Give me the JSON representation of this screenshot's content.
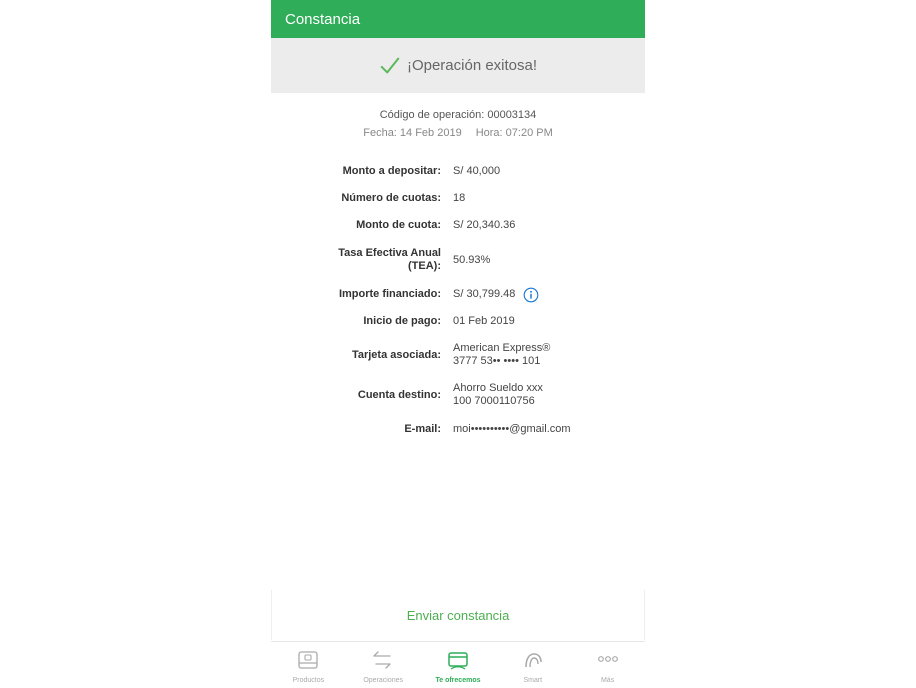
{
  "header": {
    "title": "Constancia"
  },
  "success": {
    "message": "¡Operación exitosa!",
    "icon": "check-icon"
  },
  "meta": {
    "code": "Código de operación: 00003134",
    "date": "Fecha: 14 Feb 2019",
    "time": "Hora: 07:20 PM"
  },
  "details": [
    {
      "label": "Monto a depositar:",
      "value": "S/ 40,000"
    },
    {
      "label": "Número de cuotas:",
      "value": "18"
    },
    {
      "label": "Monto de cuota:",
      "value": "S/ 20,340.36"
    },
    {
      "label": "Tasa Efectiva Anual (TEA):",
      "value": "50.93%"
    },
    {
      "label": "Importe financiado:",
      "value": "S/ 30,799.48",
      "icon": "info-icon"
    },
    {
      "label": "Inicio de pago:",
      "value": "01 Feb 2019"
    },
    {
      "label": "Tarjeta asociada:",
      "value": "American Express®",
      "value2": "3777 53•• •••• 101"
    },
    {
      "label": "Cuenta destino:",
      "value": "Ahorro Sueldo xxx",
      "value2": "100 7000110756"
    },
    {
      "label": "E-mail:",
      "value": "moi••••••••••@gmail.com"
    }
  ],
  "actions": {
    "send_label": "Enviar constancia"
  },
  "tabs": [
    {
      "label": "Productos",
      "icon": "wallet-icon"
    },
    {
      "label": "Operaciones",
      "icon": "transfer-arrows-icon"
    },
    {
      "label": "Te ofrecemos",
      "icon": "offer-card-icon",
      "active": true
    },
    {
      "label": "Smart",
      "icon": "smart-hand-icon"
    },
    {
      "label": "Más",
      "icon": "more-dots-icon"
    }
  ],
  "colors": {
    "brand": "#2fad58",
    "success_bg": "#ececec",
    "info": "#1976d2",
    "action": "#4caf50"
  }
}
